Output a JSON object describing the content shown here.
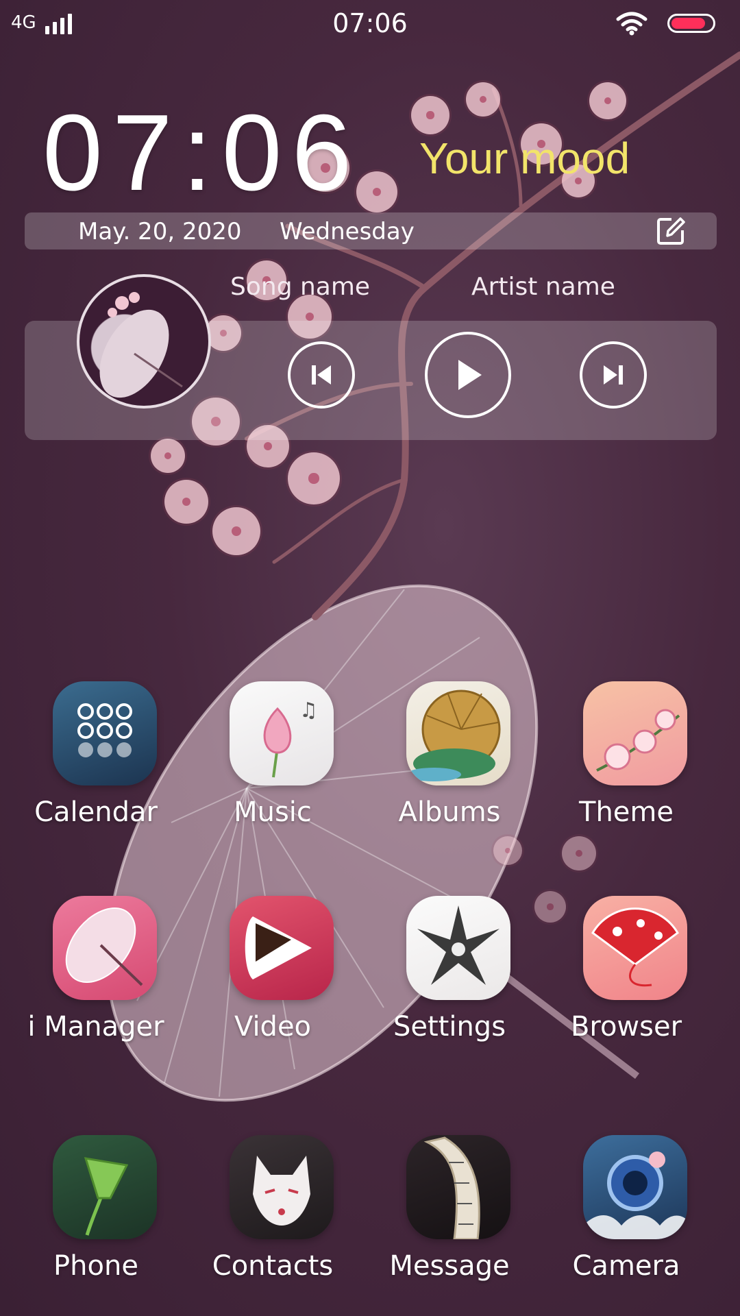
{
  "status_bar": {
    "network": "4G",
    "time": "07:06",
    "signal_icon": "signal-bars-icon",
    "wifi_icon": "wifi-icon",
    "battery_icon": "battery-icon",
    "battery_level": 0.85,
    "battery_color": "#ff2f5a"
  },
  "clock_widget": {
    "time": "07:06",
    "mood": "Your mood",
    "mood_color": "#f2e46a",
    "date": "May. 20, 2020",
    "weekday": "Wednesday",
    "edit_icon": "edit-icon"
  },
  "music_widget": {
    "song": "Song name",
    "artist": "Artist name",
    "controls": {
      "previous_icon": "previous-icon",
      "play_icon": "play-icon",
      "next_icon": "next-icon"
    }
  },
  "apps": [
    {
      "label": "Calendar",
      "icon": "calendar-icon"
    },
    {
      "label": "Music",
      "icon": "music-icon"
    },
    {
      "label": "Albums",
      "icon": "albums-icon"
    },
    {
      "label": "Theme",
      "icon": "theme-icon"
    },
    {
      "label": "i Manager",
      "icon": "i-manager-icon"
    },
    {
      "label": "Video",
      "icon": "video-icon"
    },
    {
      "label": "Settings",
      "icon": "settings-icon"
    },
    {
      "label": "Browser",
      "icon": "browser-icon"
    }
  ],
  "dock": [
    {
      "label": "Phone",
      "icon": "phone-icon"
    },
    {
      "label": "Contacts",
      "icon": "contacts-icon"
    },
    {
      "label": "Message",
      "icon": "message-icon"
    },
    {
      "label": "Camera",
      "icon": "camera-icon"
    }
  ]
}
